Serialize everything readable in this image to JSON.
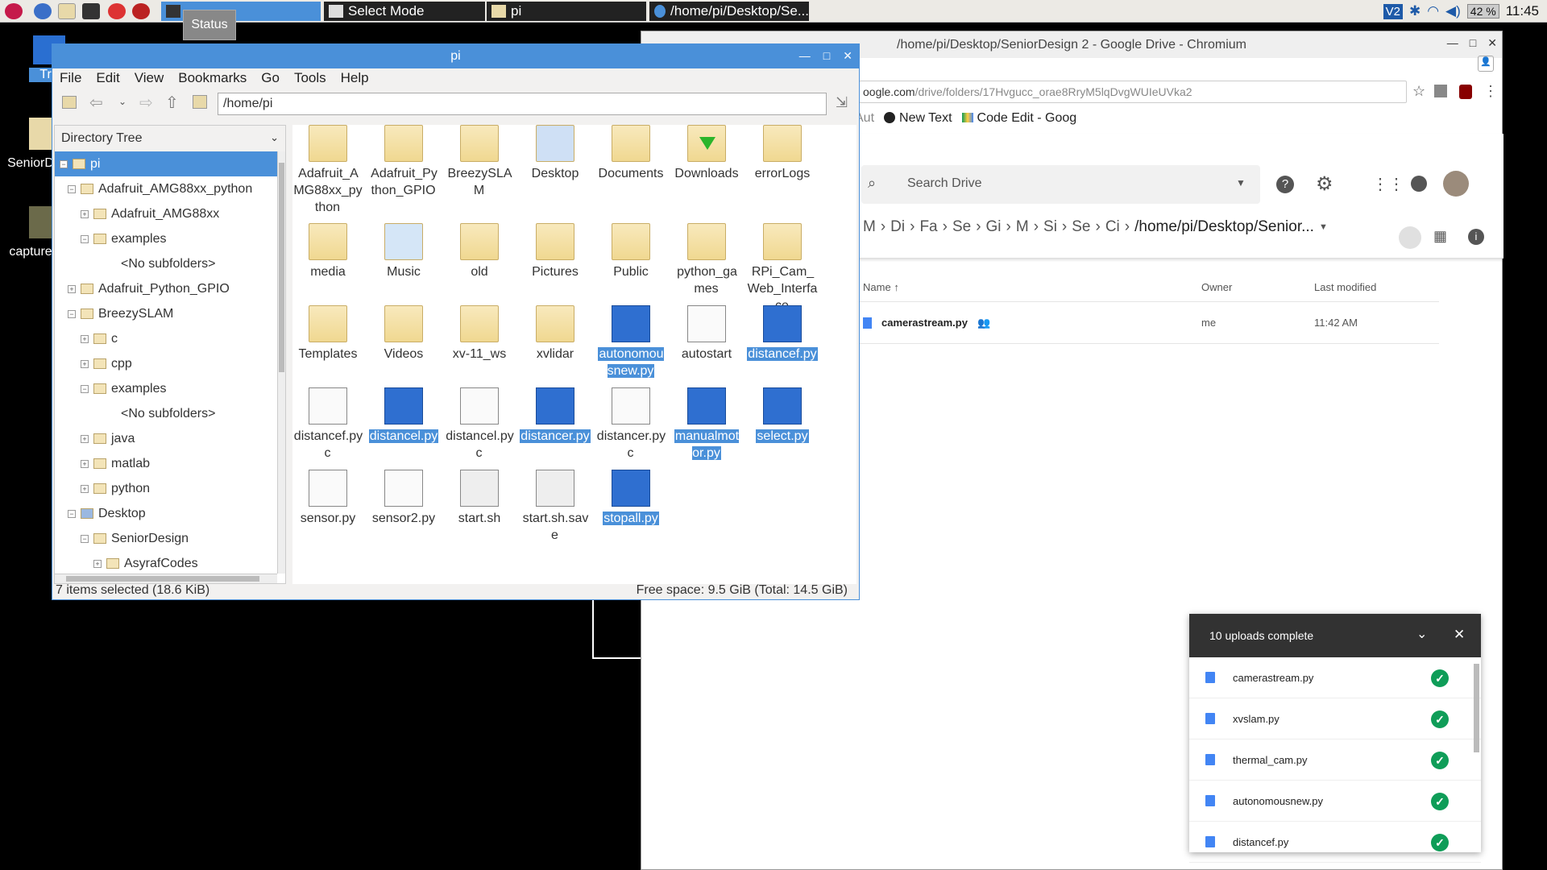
{
  "taskbar": {
    "tooltip": "Status",
    "tasks": [
      {
        "label": ""
      },
      {
        "label": "Select Mode"
      },
      {
        "label": "pi"
      },
      {
        "label": "/home/pi/Desktop/Se..."
      }
    ],
    "battery": "42 %",
    "clock": "11:45",
    "vnc": "V2"
  },
  "desktop": {
    "icons": [
      {
        "label": "Tra"
      },
      {
        "label": "SeniorD"
      },
      {
        "label": "capture"
      }
    ]
  },
  "chromium": {
    "title": "/home/pi/Desktop/SeniorDesign 2 - Google Drive - Chromium",
    "url_host": "oogle.com",
    "url_path": "/drive/folders/17Hvgucc_orae8RryM5lqDvgWUIeUVka2",
    "bookmarks": [
      {
        "label": "Aut"
      },
      {
        "label": "New Text"
      },
      {
        "label": "Code Edit - Goog"
      }
    ],
    "drive": {
      "search_placeholder": "Search Drive",
      "crumbs": [
        "M",
        "Di",
        "Fa",
        "Se",
        "Gi",
        "M",
        "Si",
        "Se",
        "Ci"
      ],
      "current_folder": "/home/pi/Desktop/Senior...",
      "columns": {
        "name": "Name",
        "owner": "Owner",
        "modified": "Last modified"
      },
      "files": [
        {
          "name": "camerastream.py",
          "owner": "me",
          "modified": "11:42 AM"
        }
      ]
    },
    "uploads": {
      "title": "10 uploads complete",
      "items": [
        {
          "name": "camerastream.py"
        },
        {
          "name": "xvslam.py"
        },
        {
          "name": "thermal_cam.py"
        },
        {
          "name": "autonomousnew.py"
        },
        {
          "name": "distancef.py"
        }
      ]
    }
  },
  "filemanager": {
    "title": "pi",
    "menu": [
      "File",
      "Edit",
      "View",
      "Bookmarks",
      "Go",
      "Tools",
      "Help"
    ],
    "path": "/home/pi",
    "tree_header": "Directory Tree",
    "tree": [
      {
        "label": "pi"
      },
      {
        "label": "Adafruit_AMG88xx_python"
      },
      {
        "label": "Adafruit_AMG88xx"
      },
      {
        "label": "examples"
      },
      {
        "label": "<No subfolders>"
      },
      {
        "label": "Adafruit_Python_GPIO"
      },
      {
        "label": "BreezySLAM"
      },
      {
        "label": "c"
      },
      {
        "label": "cpp"
      },
      {
        "label": "examples"
      },
      {
        "label": "<No subfolders>"
      },
      {
        "label": "java"
      },
      {
        "label": "matlab"
      },
      {
        "label": "python"
      },
      {
        "label": "Desktop"
      },
      {
        "label": "SeniorDesign"
      },
      {
        "label": "AsyrafCodes"
      }
    ],
    "files": [
      {
        "label": "Adafruit_AMG88xx_python"
      },
      {
        "label": "Adafruit_Python_GPIO"
      },
      {
        "label": "BreezySLAM"
      },
      {
        "label": "Desktop"
      },
      {
        "label": "Documents"
      },
      {
        "label": "Downloads"
      },
      {
        "label": "errorLogs"
      },
      {
        "label": "media"
      },
      {
        "label": "Music"
      },
      {
        "label": "old"
      },
      {
        "label": "Pictures"
      },
      {
        "label": "Public"
      },
      {
        "label": "python_games"
      },
      {
        "label": "RPi_Cam_Web_Interface"
      },
      {
        "label": "Templates"
      },
      {
        "label": "Videos"
      },
      {
        "label": "xv-11_ws"
      },
      {
        "label": "xvlidar"
      },
      {
        "label": "autonomousnew.py"
      },
      {
        "label": "autostart"
      },
      {
        "label": "distancef.py"
      },
      {
        "label": "distancef.pyc"
      },
      {
        "label": "distancel.py"
      },
      {
        "label": "distancel.pyc"
      },
      {
        "label": "distancer.py"
      },
      {
        "label": "distancer.pyc"
      },
      {
        "label": "manualmotor.py"
      },
      {
        "label": "select.py"
      },
      {
        "label": "sensor.py"
      },
      {
        "label": "sensor2.py"
      },
      {
        "label": "start.sh"
      },
      {
        "label": "start.sh.save"
      },
      {
        "label": "stopall.py"
      }
    ],
    "status_left": "7 items selected (18.6 KiB)",
    "status_right": "Free space: 9.5 GiB (Total: 14.5 GiB)"
  }
}
